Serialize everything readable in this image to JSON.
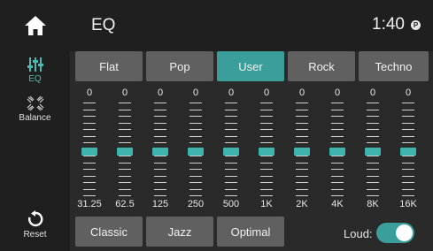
{
  "header": {
    "title": "EQ",
    "time": "1:40",
    "status_icon": "P"
  },
  "sidebar": {
    "items": [
      {
        "label": "EQ",
        "icon": "eq-sliders-icon",
        "active": true
      },
      {
        "label": "Balance",
        "icon": "balance-icon",
        "active": false
      }
    ],
    "reset_label": "Reset"
  },
  "presets": [
    "Flat",
    "Pop",
    "User",
    "Rock",
    "Techno",
    "Classic",
    "Jazz",
    "Optimal"
  ],
  "active_preset": "User",
  "bands": [
    {
      "freq": "31.25",
      "gain": "0"
    },
    {
      "freq": "62.5",
      "gain": "0"
    },
    {
      "freq": "125",
      "gain": "0"
    },
    {
      "freq": "250",
      "gain": "0"
    },
    {
      "freq": "500",
      "gain": "0"
    },
    {
      "freq": "1K",
      "gain": "0"
    },
    {
      "freq": "2K",
      "gain": "0"
    },
    {
      "freq": "4K",
      "gain": "0"
    },
    {
      "freq": "8K",
      "gain": "0"
    },
    {
      "freq": "16K",
      "gain": "0"
    }
  ],
  "loud": {
    "label": "Loud:",
    "on": true
  },
  "colors": {
    "accent": "#3fb3ad",
    "button": "#606060",
    "panel": "#1f1f1f",
    "background": "#2a2a2a"
  }
}
